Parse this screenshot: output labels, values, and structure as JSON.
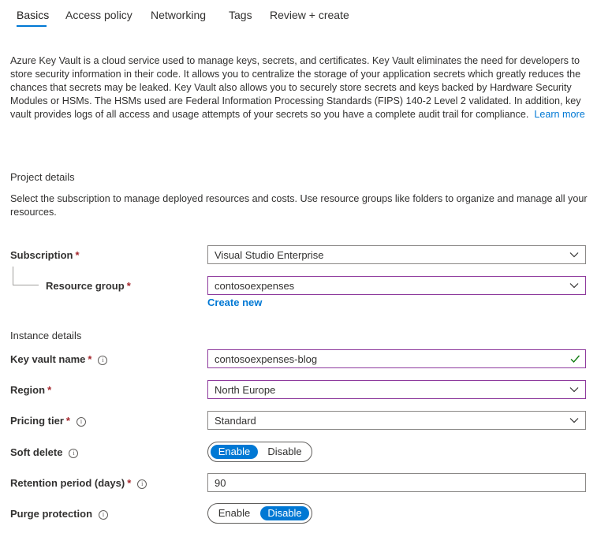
{
  "tabs": [
    {
      "label": "Basics",
      "active": true
    },
    {
      "label": "Access policy"
    },
    {
      "label": "Networking"
    },
    {
      "label": "Tags"
    },
    {
      "label": "Review + create"
    }
  ],
  "intro": {
    "text": "Azure Key Vault is a cloud service used to manage keys, secrets, and certificates. Key Vault eliminates the need for developers to store security information in their code. It allows you to centralize the storage of your application secrets which greatly reduces the chances that secrets may be leaked. Key Vault also allows you to securely store secrets and keys backed by Hardware Security Modules or HSMs. The HSMs used are Federal Information Processing Standards (FIPS) 140-2 Level 2 validated. In addition, key vault provides logs of all access and usage attempts of your secrets so you have a complete audit trail for compliance.",
    "learn_more": "Learn more"
  },
  "project": {
    "heading": "Project details",
    "description": "Select the subscription to manage deployed resources and costs. Use resource groups like folders to organize and manage all your resources.",
    "subscription_label": "Subscription",
    "subscription_value": "Visual Studio Enterprise",
    "resource_group_label": "Resource group",
    "resource_group_value": "contosoexpenses",
    "create_new": "Create new"
  },
  "instance": {
    "heading": "Instance details",
    "key_vault_name_label": "Key vault name",
    "key_vault_name_value": "contosoexpenses-blog",
    "region_label": "Region",
    "region_value": "North Europe",
    "pricing_tier_label": "Pricing tier",
    "pricing_tier_value": "Standard",
    "soft_delete_label": "Soft delete",
    "soft_delete_selected": "Enable",
    "retention_label": "Retention period (days)",
    "retention_value": "90",
    "purge_label": "Purge protection",
    "purge_selected": "Disable"
  },
  "common": {
    "required_mark": "*",
    "info_glyph": "i",
    "enable": "Enable",
    "disable": "Disable"
  },
  "colors": {
    "accent": "#0078d4",
    "required": "#a4262c",
    "focus_border": "#8e3a9d",
    "valid": "#107c10"
  },
  "icons": {
    "dropdown": "chevron-down-icon",
    "valid": "checkmark-icon",
    "info": "info-icon"
  }
}
